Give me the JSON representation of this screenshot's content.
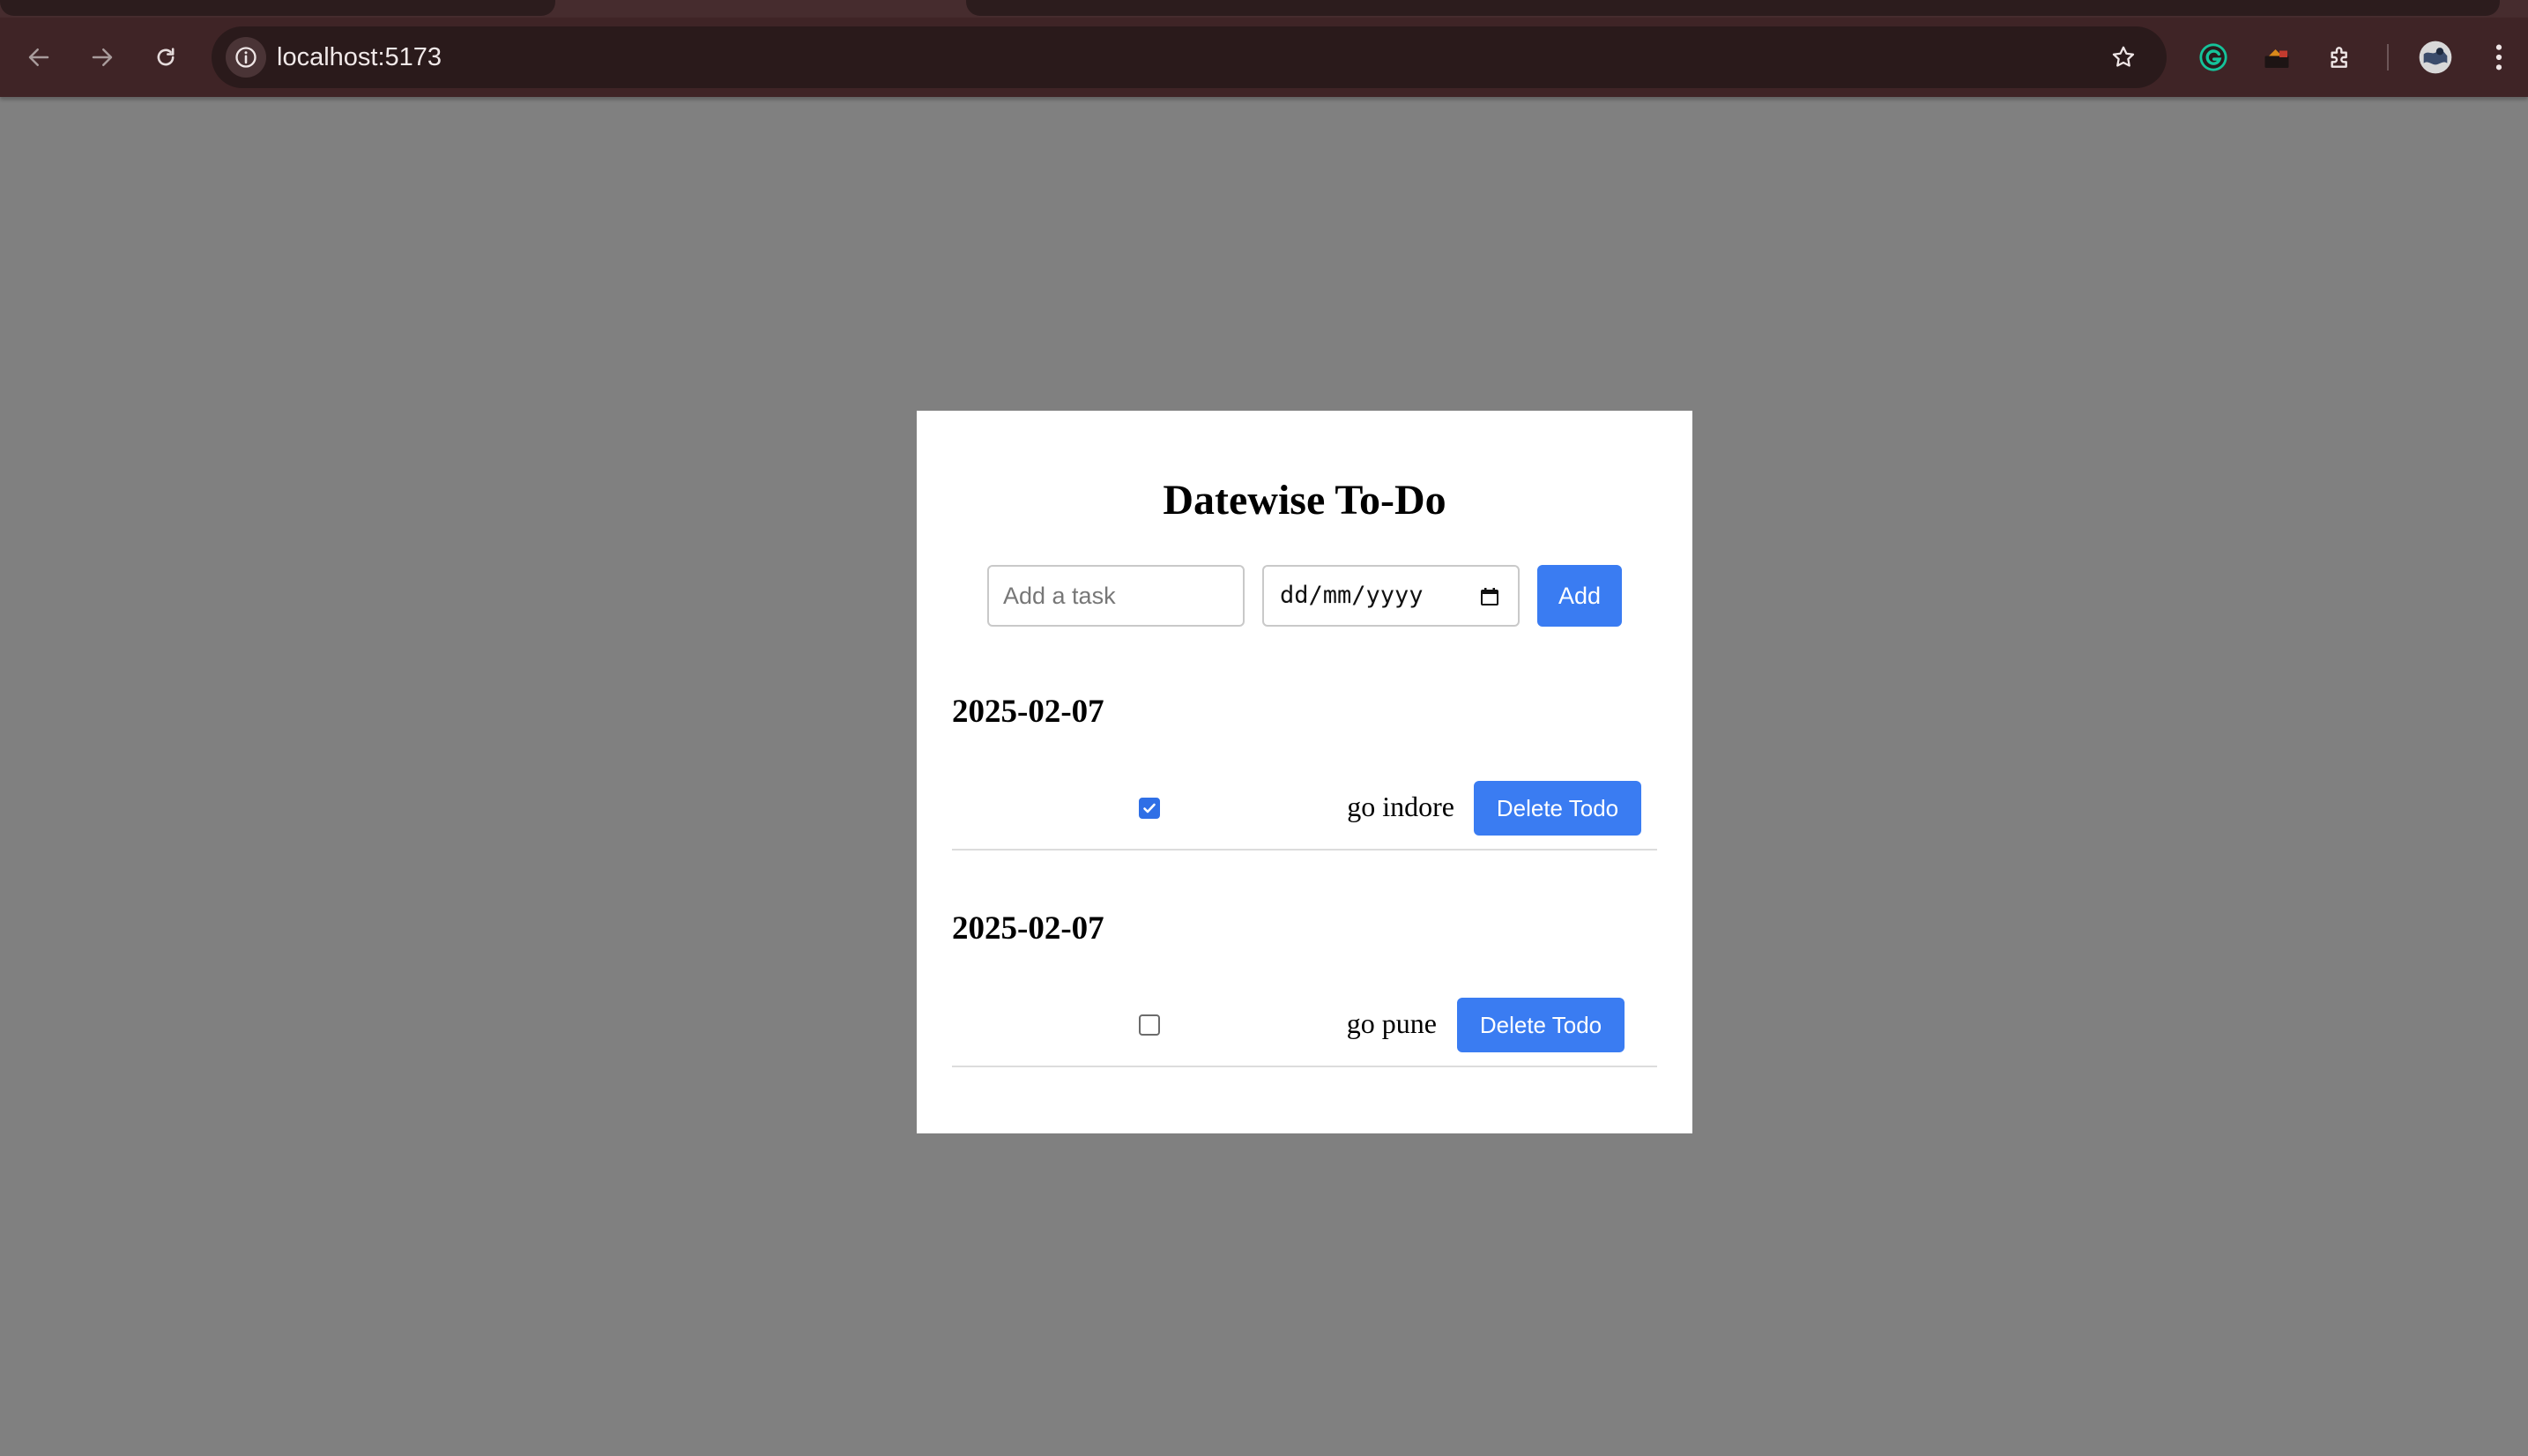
{
  "browser": {
    "url": "localhost:5173",
    "icons": {
      "back": "back-arrow-icon",
      "forward": "forward-arrow-icon",
      "reload": "reload-icon",
      "info": "info-icon",
      "bookmark": "star-icon",
      "grammarly": "grammarly-extension-icon",
      "extension2": "extension-icon",
      "extensions": "puzzle-icon",
      "profile": "profile-avatar-icon",
      "menu": "kebab-menu-icon"
    },
    "colors": {
      "toolbar": "#3f2426",
      "omnibox": "#2a1a1b",
      "page_background": "#808080"
    }
  },
  "app": {
    "title": "Datewise To-Do",
    "task_placeholder": "Add a task",
    "date_placeholder": "dd/mm/yyyy",
    "add_label": "Add",
    "accent": "#3a7cf2",
    "groups": [
      {
        "date": "2025-02-07",
        "todos": [
          {
            "text": "go indore",
            "completed": true,
            "delete_label": "Delete Todo"
          }
        ]
      },
      {
        "date": "2025-02-07",
        "todos": [
          {
            "text": "go pune",
            "completed": false,
            "delete_label": "Delete Todo"
          }
        ]
      }
    ]
  }
}
